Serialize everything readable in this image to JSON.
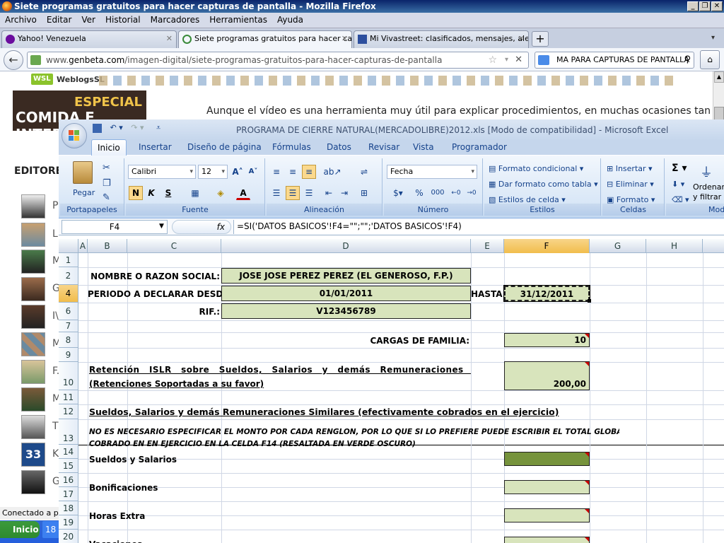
{
  "browser": {
    "window_title": "Siete programas gratuitos para hacer capturas de pantalla - Mozilla Firefox",
    "menu": [
      "Archivo",
      "Editar",
      "Ver",
      "Historial",
      "Marcadores",
      "Herramientas",
      "Ayuda"
    ],
    "tabs": [
      {
        "label": "Yahoo! Venezuela",
        "active": false
      },
      {
        "label": "Siete programas gratuitos para hacer ca...",
        "active": true
      },
      {
        "label": "Mi Vivastreet: clasificados, mensajes, ale...",
        "active": false
      }
    ],
    "new_tab": "+",
    "url_prefix": "www.",
    "url_domain": "genbeta.com",
    "url_path": "/imagen-digital/siete-programas-gratuitos-para-hacer-capturas-de-pantalla",
    "search_value": "MA PARA CAPTURAS DE PANTALLA",
    "status": "Conectado a pla",
    "start_label": "Inicio",
    "task_label": "18"
  },
  "page": {
    "weblogs_label": "WeblogsSL",
    "wsl_label": "WSL",
    "banner_line1": "ESPECIAL",
    "banner_line2": "COMIDA E INTERNET",
    "article_text": "Aunque el vídeo es una herramienta muy útil para explicar procedimientos, en muchas ocasiones tan",
    "editores_label": "EDITORE",
    "editor_initials": [
      "P",
      "L",
      "M",
      "G",
      "I\\",
      "M",
      "F.",
      "M",
      "",
      "T",
      "K",
      "G"
    ]
  },
  "excel": {
    "title": "PROGRAMA DE CIERRE NATURAL(MERCADOLIBRE)2012.xls  [Modo de compatibilidad] - Microsoft Excel",
    "ribbon_tabs": [
      "Inicio",
      "Insertar",
      "Diseño de página",
      "Fórmulas",
      "Datos",
      "Revisar",
      "Vista",
      "Programador"
    ],
    "groups": {
      "clipboard": {
        "label": "Portapapeles",
        "paste": "Pegar"
      },
      "font": {
        "label": "Fuente",
        "font_name": "Calibri",
        "font_size": "12",
        "bold": "N",
        "italic": "K",
        "underline": "S"
      },
      "alignment": {
        "label": "Alineación"
      },
      "number": {
        "label": "Número",
        "format": "Fecha",
        "percent": "%",
        "thousands": "000"
      },
      "styles": {
        "label": "Estilos",
        "cond_format": "Formato condicional",
        "table_format": "Dar formato como tabla",
        "cell_styles": "Estilos de celda"
      },
      "cells": {
        "label": "Celdas",
        "insert": "Insertar",
        "delete": "Eliminar",
        "format": "Formato"
      },
      "editing": {
        "label": "Modi",
        "sigma": "Σ",
        "sort_line1": "Ordenar",
        "sort_line2": "y filtrar"
      }
    },
    "name_box": "F4",
    "fx": "fx",
    "formula": "=SI('DATOS BASICOS'!F4=\"\";\"\";'DATOS BASICOS'!F4)",
    "columns": [
      "A",
      "B",
      "C",
      "D",
      "E",
      "F",
      "G",
      "H"
    ],
    "rows": [
      "1",
      "2",
      "4",
      "6",
      "7",
      "8",
      "9",
      "10",
      "11",
      "12",
      "13",
      "14",
      "15",
      "16",
      "17",
      "18",
      "19",
      "20"
    ],
    "cells": {
      "r2_label": "NOMBRE O RAZON SOCIAL:",
      "r2_value": "JOSE JOSE PEREZ PEREZ (EL GENEROSO, F.P.)",
      "r4_label": "PERIODO A DECLARAR DESDE",
      "r4_from": "01/01/2011",
      "r4_hasta": "HASTA:",
      "r4_to": "31/12/2011",
      "r6_label": "RIF.:",
      "r6_value": "V123456789",
      "r8_label": "CARGAS DE FAMILIA:",
      "r8_value": "10",
      "r10_line1": "Retención ISLR sobre Sueldos, Salarios y demás Remuneraciones Similares",
      "r10_line2": "(Retenciones Soportadas a su favor)",
      "r10_value": "200,00",
      "r12_text": "Sueldos, Salarios y demás Remuneraciones Similares (efectivamente cobrados en el ejercicio)",
      "r13_line1": "NO ES NECESARIO ESPECIFICAR EL MONTO POR CADA RENGLON, POR LO QUE SI LO PREFIERE PUEDE ESCRIBIR EL TOTAL GLOBAL",
      "r13_line2": "COBRADO EN EN EJERCICIO EN LA  CELDA F14 (RESALTADA EN VERDE OSCURO)",
      "r14_label": "Sueldos y Salarios",
      "r16_label": "Bonificaciones",
      "r18_label": "Horas Extra",
      "r20_label": "Vacaciones"
    }
  }
}
